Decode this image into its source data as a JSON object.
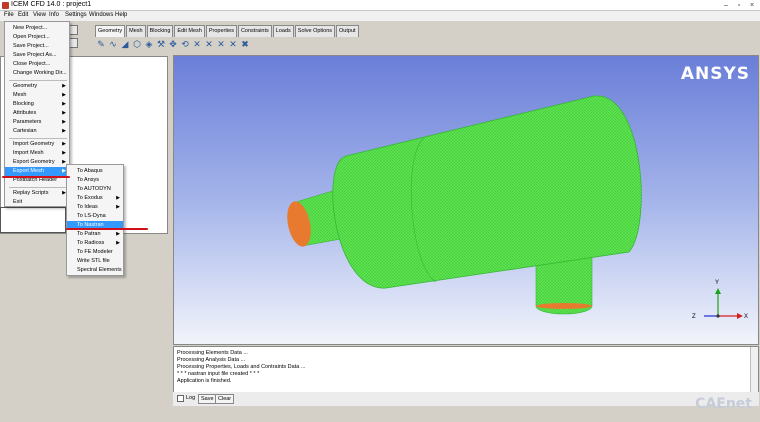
{
  "window": {
    "title": "ICEM CFD 14.0 : project1"
  },
  "menubar": [
    "File",
    "Edit",
    "View",
    "Info",
    "Settings",
    "Windows",
    "Help"
  ],
  "tabs": [
    "Geometry",
    "Mesh",
    "Blocking",
    "Edit Mesh",
    "Properties",
    "Constraints",
    "Loads",
    "Solve Options",
    "Output"
  ],
  "file_menu": {
    "items": [
      "New Project...",
      "Open Project...",
      "Save Project...",
      "Save Project As...",
      "Close Project...",
      "Change Working Dir...",
      "Geometry",
      "Mesh",
      "Blocking",
      "Attributes",
      "Parameters",
      "Cartesian",
      "Import Geometry",
      "Import Mesh",
      "Export Geometry",
      "Export Mesh",
      "Postbatch Header",
      "Replay Scripts",
      "Exit"
    ],
    "highlighted": "Export Mesh"
  },
  "export_submenu": {
    "items": [
      "To Abaqus",
      "To Ansys",
      "To AUTODYN",
      "To Exodus",
      "To Ideas",
      "To LS-Dyna",
      "To Nastran",
      "To Patran",
      "To Radioss",
      "To FE Modeler",
      "Write STL file",
      "Spectral Elements"
    ],
    "highlighted": "To Nastran"
  },
  "viewport": {
    "brand": "ANSYS",
    "axes": {
      "x": "X",
      "y": "Y",
      "z": "Z"
    },
    "mesh_color": "#55e04a",
    "face_color": "#e87a30"
  },
  "messages": [
    "Processing Elements Data ...",
    "Processing Analysis Data ...",
    "Processing Properties, Loads and Contraints Data ...",
    "* * * nastran input file created * * *",
    "Application is finished."
  ],
  "bottom": {
    "log_label": "Log",
    "save_label": "Save",
    "clear_label": "Clear"
  },
  "watermark": "CAEnet"
}
